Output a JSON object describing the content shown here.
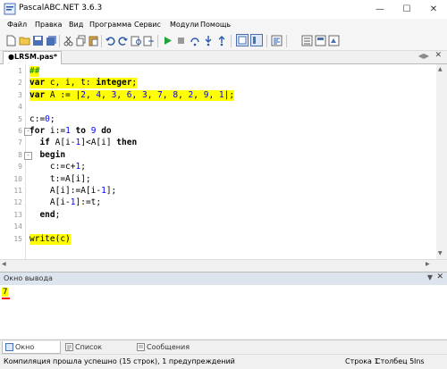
{
  "window": {
    "title": "PascalABC.NET 3.6.3"
  },
  "menu": [
    "Файл",
    "Правка",
    "Вид",
    "Программа",
    "Сервис",
    "Модули",
    "Помощь"
  ],
  "toolbar_icons": [
    "new-file-icon",
    "open-folder-icon",
    "save-icon",
    "save-all-icon",
    "cut-icon",
    "copy-icon",
    "paste-icon",
    "undo-icon",
    "redo-icon",
    "find-icon",
    "replace-icon",
    "run-icon",
    "stop-icon",
    "step-over-icon",
    "step-into-icon",
    "console-window-icon",
    "debug-window-icon",
    "format-icon",
    "compile-icon",
    "properties-icon",
    "settings-icon"
  ],
  "tab": {
    "label": "●LRSM.pas*"
  },
  "editor": {
    "lines": [
      {
        "n": "1",
        "text": "##"
      },
      {
        "n": "2",
        "text": "var c, i, t: integer;"
      },
      {
        "n": "3",
        "text": "var A := |2, 4, 3, 6, 3, 7, 8, 2, 9, 1|;"
      },
      {
        "n": "4",
        "text": ""
      },
      {
        "n": "5",
        "text": "c:=0;"
      },
      {
        "n": "6",
        "text": "for i:=1 to 9 do"
      },
      {
        "n": "7",
        "text": "  if A[i-1]<A[i] then"
      },
      {
        "n": "8",
        "text": "  begin"
      },
      {
        "n": "9",
        "text": "    c:=c+1;"
      },
      {
        "n": "10",
        "text": "    t:=A[i];"
      },
      {
        "n": "11",
        "text": "    A[i]:=A[i-1];"
      },
      {
        "n": "12",
        "text": "    A[i-1]:=t;"
      },
      {
        "n": "13",
        "text": "  end;"
      },
      {
        "n": "14",
        "text": ""
      },
      {
        "n": "15",
        "text": "write(c)"
      }
    ]
  },
  "output": {
    "title": "Окно вывода",
    "value": "7"
  },
  "bottom_tabs": [
    "Окно вывода",
    "Список ошибок",
    "Сообщения компилятора"
  ],
  "status": {
    "message": "Компиляция прошла успешно (15 строк), 1 предупреждений",
    "row": "Строка  1",
    "col": "Столбец  5",
    "mode": "Ins"
  },
  "colors": {
    "highlight": "#ffff00",
    "accent": "#1f6fbf"
  }
}
